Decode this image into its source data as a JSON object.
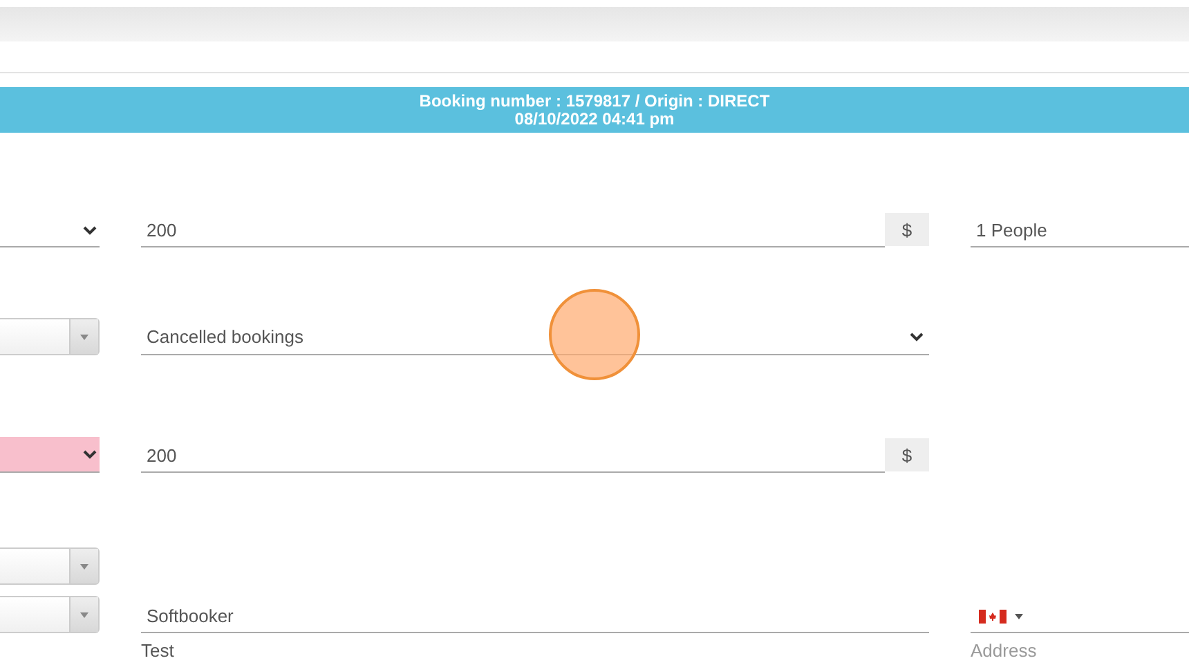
{
  "banner": {
    "title": "Booking number : 1579817 / Origin : DIRECT",
    "date": "08/10/2022 04:41 pm"
  },
  "rows": [
    {
      "left": {
        "kind": "select",
        "invalid": false
      },
      "middle": {
        "kind": "amount",
        "value": "200",
        "addon": "$"
      },
      "right": {
        "kind": "text",
        "value": "1 People"
      }
    },
    {
      "left": {
        "kind": "combo"
      },
      "middle": {
        "kind": "select",
        "value": "Cancelled bookings"
      }
    },
    {
      "left": {
        "kind": "select",
        "invalid": true
      },
      "middle": {
        "kind": "amount",
        "value": "200",
        "addon": "$"
      }
    },
    {
      "left": {
        "kind": "combo"
      }
    },
    {
      "left": {
        "kind": "combo"
      },
      "middle": {
        "kind": "text",
        "value": "Softbooker"
      },
      "right": {
        "kind": "phone"
      }
    },
    {
      "middle": {
        "kind": "plain",
        "value": "Test"
      },
      "right": {
        "kind": "input",
        "placeholder": "Address"
      }
    }
  ]
}
